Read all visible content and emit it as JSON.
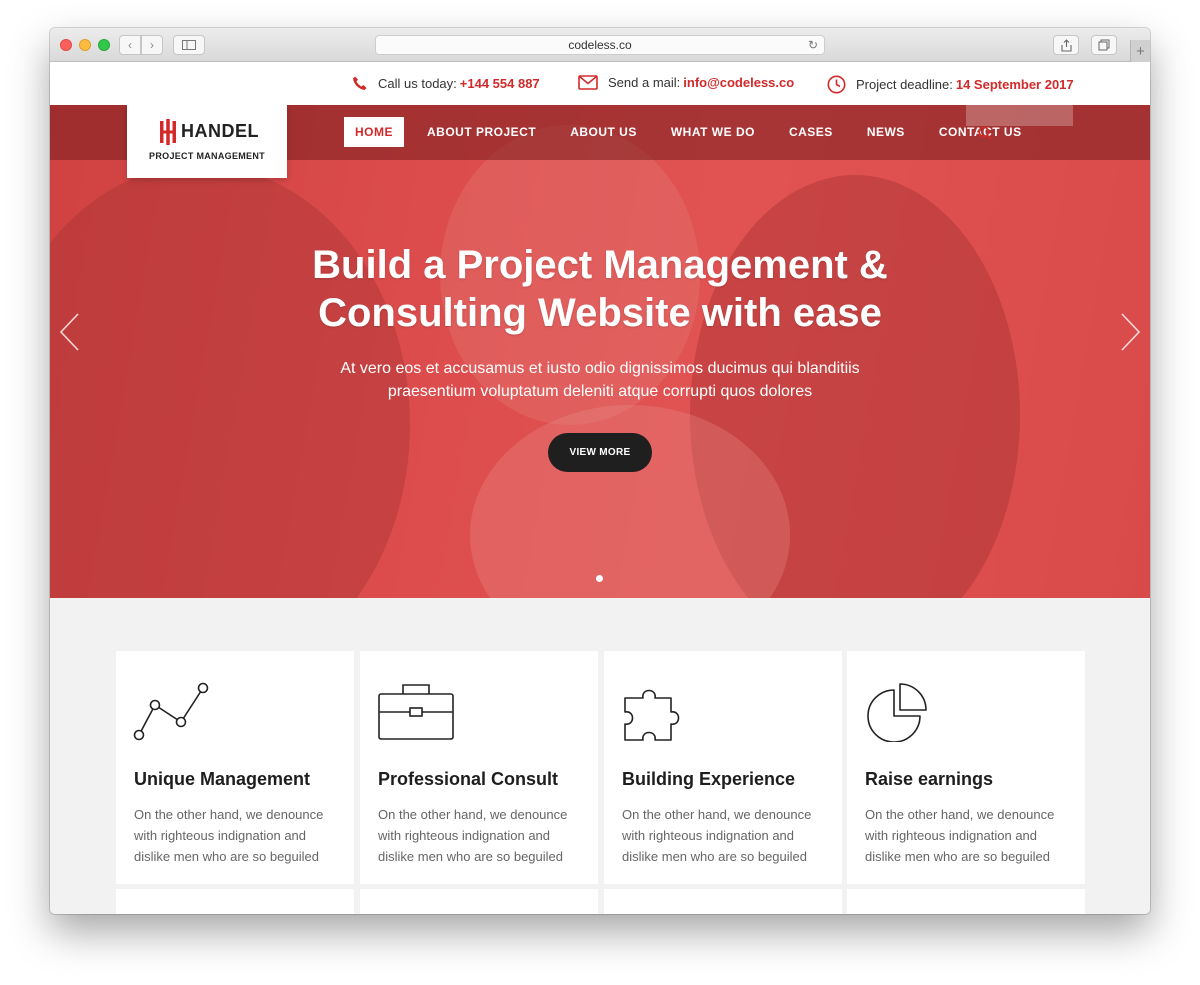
{
  "browser": {
    "url": "codeless.co"
  },
  "topbar": {
    "call_label": "Call us today:",
    "call_value": "+144 554 887",
    "mail_label": "Send a mail:",
    "mail_value": "info@codeless.co",
    "deadline_label": "Project deadline:",
    "deadline_value": "14 September 2017"
  },
  "logo": {
    "name": "HANDEL",
    "subtitle": "PROJECT MANAGEMENT"
  },
  "nav": {
    "items": [
      "HOME",
      "ABOUT PROJECT",
      "ABOUT US",
      "WHAT WE DO",
      "CASES",
      "NEWS",
      "CONTACT US"
    ],
    "active_index": 0
  },
  "hero": {
    "title_line1": "Build a Project Management &",
    "title_line2": "Consulting Website with ease",
    "subtitle_line1": "At vero eos et accusamus et iusto odio dignissimos ducimus qui blanditiis",
    "subtitle_line2": "praesentium voluptatum deleniti atque corrupti quos dolores",
    "button": "VIEW MORE",
    "slide_count": 1,
    "active_slide": 1
  },
  "features": [
    {
      "icon": "line-chart-icon",
      "title": "Unique Management",
      "text": "On the other hand, we denounce with righteous indignation and dislike men who are so beguiled"
    },
    {
      "icon": "toolbox-icon",
      "title": "Professional Consult",
      "text": "On the other hand, we denounce with righteous indignation and dislike men who are so beguiled"
    },
    {
      "icon": "puzzle-icon",
      "title": "Building Experience",
      "text": "On the other hand, we denounce with righteous indignation and dislike men who are so beguiled"
    },
    {
      "icon": "pie-chart-icon",
      "title": "Raise earnings",
      "text": "On the other hand, we denounce with righteous indignation and dislike men who are so beguiled"
    }
  ],
  "colors": {
    "accent": "#d22a2a",
    "hero_overlay": "#d93a3a",
    "button_dark": "#1f1f1f",
    "section_bg": "#f2f2f2"
  }
}
